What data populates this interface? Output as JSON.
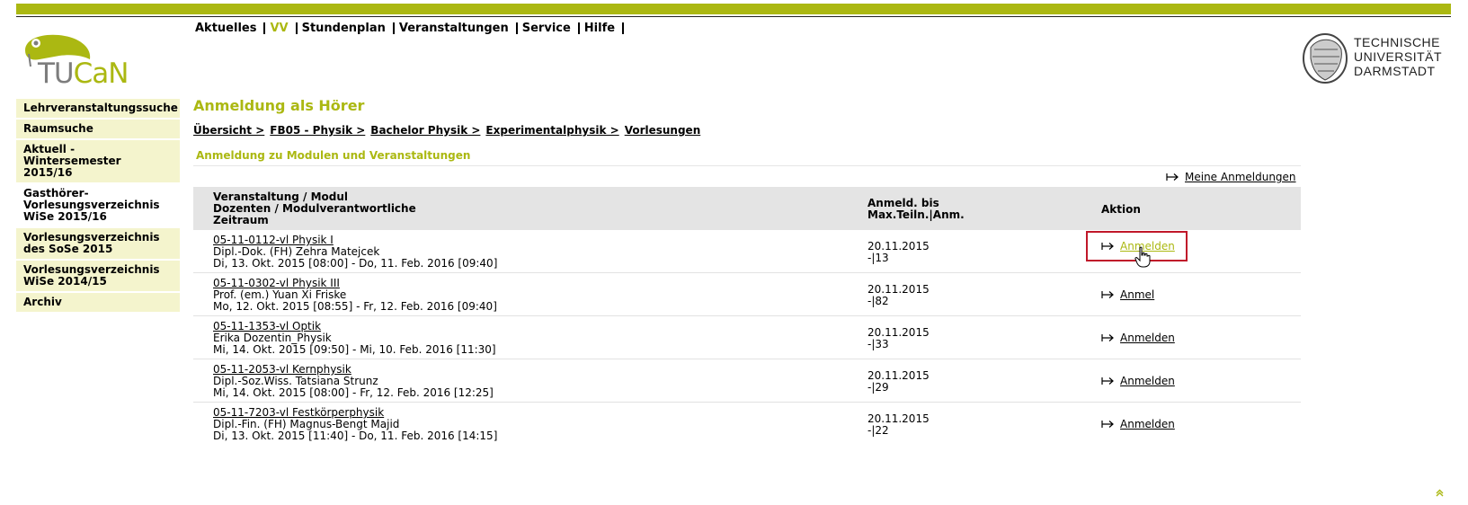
{
  "app": {
    "logo_tu": "TU",
    "logo_can": "CaN"
  },
  "university": {
    "line1": "TECHNISCHE",
    "line2": "UNIVERSITÄT",
    "line3": "DARMSTADT"
  },
  "topnav": [
    {
      "label": "Aktuelles",
      "active": false
    },
    {
      "label": "VV",
      "active": true
    },
    {
      "label": "Stundenplan",
      "active": false
    },
    {
      "label": "Veranstaltungen",
      "active": false
    },
    {
      "label": "Service",
      "active": false
    },
    {
      "label": "Hilfe",
      "active": false
    }
  ],
  "sidebar": {
    "items": [
      {
        "label": "Lehrveranstaltungssuche"
      },
      {
        "label": "Raumsuche"
      },
      {
        "label": "Aktuell - Wintersemester 2015/16"
      },
      {
        "label": "Gasthörer-Vorlesungsverzeichnis WiSe 2015/16"
      },
      {
        "label": "Vorlesungsverzeichnis des SoSe 2015"
      },
      {
        "label": "Vorlesungsverzeichnis WiSe 2014/15"
      },
      {
        "label": "Archiv"
      }
    ]
  },
  "main": {
    "title": "Anmeldung als Hörer",
    "breadcrumb": [
      "Übersicht >",
      "FB05 - Physik >",
      "Bachelor Physik >",
      "Experimentalphysik >",
      "Vorlesungen"
    ],
    "subheading": "Anmeldung zu Modulen und Veranstaltungen",
    "my_registrations": "Meine Anmeldungen"
  },
  "table": {
    "headers": {
      "col1_line1": "Veranstaltung / Modul",
      "col1_line2": "Dozenten / Modulverantwortliche",
      "col1_line3": "Zeitraum",
      "col2_line1": "Anmeld. bis",
      "col2_line2": "Max.Teiln.|Anm.",
      "col3": "Aktion"
    },
    "rows": [
      {
        "title": "05-11-0112-vl Physik I",
        "lecturer": "Dipl.-Dok. (FH) Zehra Matejcek",
        "period": "Di, 13. Okt. 2015 [08:00] - Do, 11. Feb. 2016 [09:40]",
        "deadline": "20.11.2015",
        "capacity": "-|13",
        "action": "Anmelden"
      },
      {
        "title": "05-11-0302-vl Physik III",
        "lecturer": "Prof. (em.) Yuan Xi Friske",
        "period": "Mo, 12. Okt. 2015 [08:55] - Fr, 12. Feb. 2016 [09:40]",
        "deadline": "20.11.2015",
        "capacity": "-|82",
        "action": "Anmel"
      },
      {
        "title": "05-11-1353-vl Optik",
        "lecturer": "Erika Dozentin_Physik",
        "period": "Mi, 14. Okt. 2015 [09:50] - Mi, 10. Feb. 2016 [11:30]",
        "deadline": "20.11.2015",
        "capacity": "-|33",
        "action": "Anmelden"
      },
      {
        "title": "05-11-2053-vl Kernphysik",
        "lecturer": "Dipl.-Soz.Wiss. Tatsiana Strunz",
        "period": "Mi, 14. Okt. 2015 [08:00] - Fr, 12. Feb. 2016 [12:25]",
        "deadline": "20.11.2015",
        "capacity": "-|29",
        "action": "Anmelden"
      },
      {
        "title": "05-11-7203-vl Festkörperphysik",
        "lecturer": "Dipl.-Fin. (FH) Magnus-Bengt Majid",
        "period": "Di, 13. Okt. 2015 [11:40] - Do, 11. Feb. 2016 [14:15]",
        "deadline": "20.11.2015",
        "capacity": "-|22",
        "action": "Anmelden"
      }
    ]
  },
  "colors": {
    "accent": "#abb812",
    "highlight": "#c0172a"
  }
}
